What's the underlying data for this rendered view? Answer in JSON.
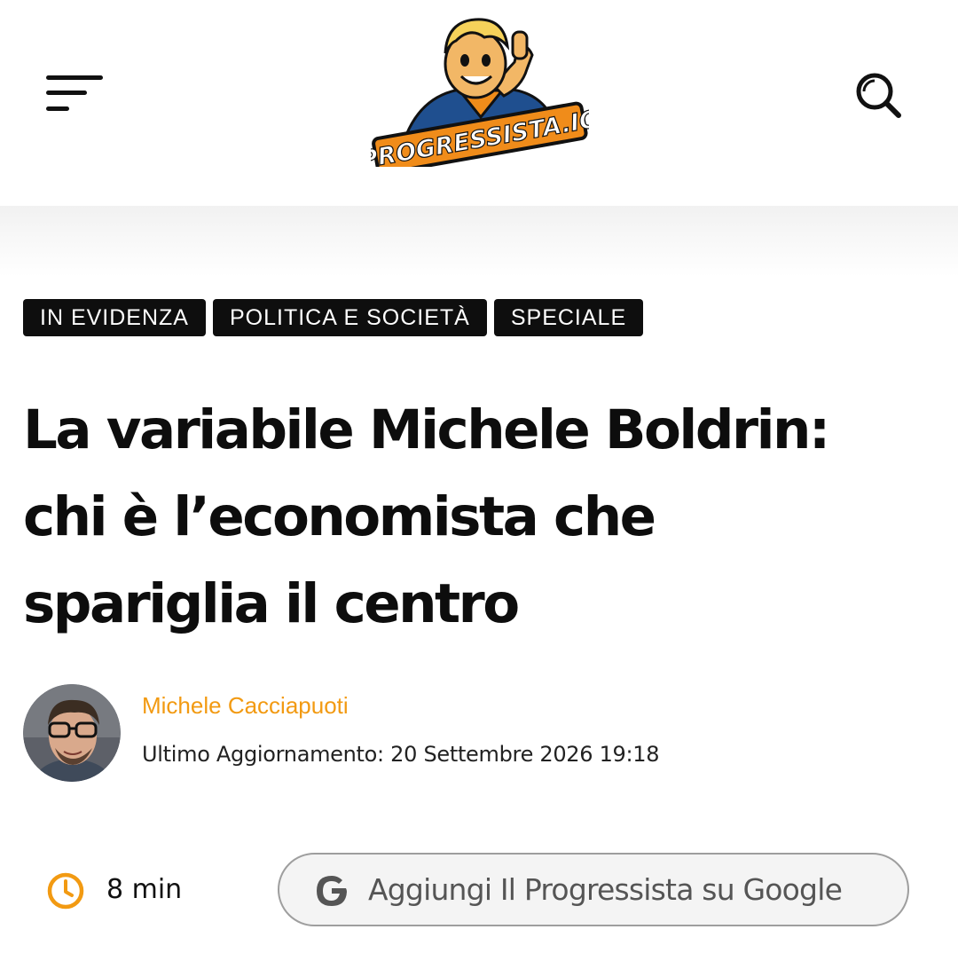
{
  "header": {
    "logo_text": "PROGRESSISTA.IO"
  },
  "tags": [
    "IN EVIDENZA",
    "POLITICA E SOCIETÀ",
    "SPECIALE"
  ],
  "article": {
    "title_lines": [
      "La variabile Michele Boldrin:",
      "chi è l’economista che",
      "spariglia il centro"
    ],
    "author": "Michele Cacciapuoti",
    "updated": "Ultimo Aggiornamento: 20 Settembre 2026 19:18",
    "read_time": "8 min"
  },
  "google_button": {
    "label": "Aggiungi Il Progressista su Google"
  },
  "colors": {
    "accent": "#f29a12",
    "tag_bg": "#0e0e0e",
    "text": "#111111",
    "button_border": "#9e9e9e",
    "button_text": "#555555"
  },
  "icons": {
    "menu": "hamburger-icon",
    "search": "search-icon",
    "clock": "clock-icon",
    "google": "google-g-icon"
  }
}
